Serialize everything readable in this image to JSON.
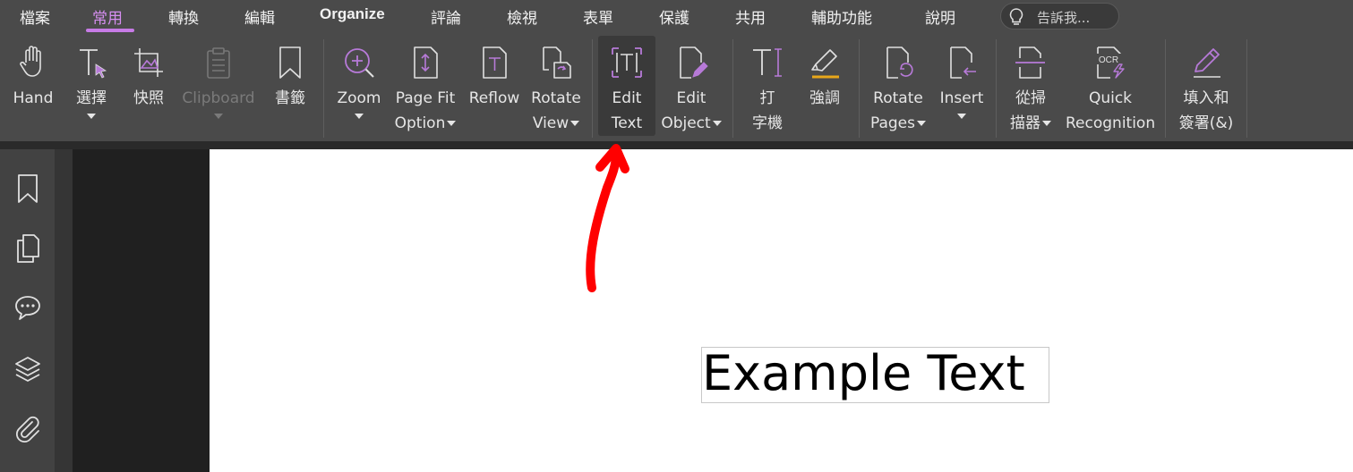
{
  "menu": {
    "items": [
      "檔案",
      "常用",
      "轉換",
      "編輯",
      "Organize",
      "評論",
      "檢視",
      "表單",
      "保護",
      "共用",
      "輔助功能",
      "說明"
    ],
    "active": "常用",
    "tell_me_placeholder": "告訴我..."
  },
  "ribbon": {
    "hand": "Hand",
    "select": "選擇",
    "snapshot": "快照",
    "clipboard": "Clipboard",
    "bookmark": "書籤",
    "zoom": "Zoom",
    "page_fit_1": "Page Fit",
    "page_fit_2": "Option",
    "reflow": "Reflow",
    "rotate_view_1": "Rotate",
    "rotate_view_2": "View",
    "edit_text_1": "Edit",
    "edit_text_2": "Text",
    "edit_object_1": "Edit",
    "edit_object_2": "Object",
    "typewriter_1": "打",
    "typewriter_2": "字機",
    "highlight": "強調",
    "rotate_pages_1": "Rotate",
    "rotate_pages_2": "Pages",
    "insert": "Insert",
    "scanner_1": "從掃",
    "scanner_2": "描器",
    "ocr_1": "Quick",
    "ocr_2": "Recognition",
    "fill_sign_1": "填入和",
    "fill_sign_2": "簽署(&)",
    "ocr_icon_text": "OCR"
  },
  "document": {
    "example_text": "Example Text"
  },
  "colors": {
    "accent": "#c77be6",
    "annotation": "#ff0000",
    "menubar": "#4a4a4a"
  }
}
